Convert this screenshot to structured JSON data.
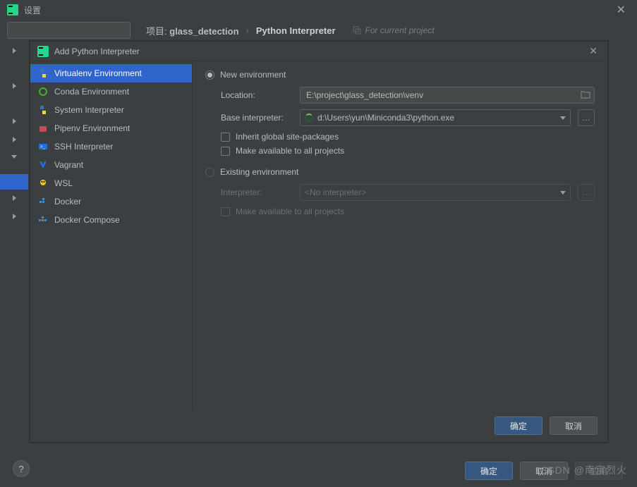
{
  "settings": {
    "title": "设置",
    "search_placeholder": " ",
    "breadcrumb": {
      "project_label": "项目:",
      "project_name": "glass_detection",
      "page": "Python Interpreter"
    },
    "for_current_project": "For current project",
    "footer": {
      "ok": "确定",
      "cancel": "取消",
      "apply": "应用"
    }
  },
  "dialog": {
    "title": "Add Python Interpreter",
    "envs": [
      {
        "label": "Virtualenv Environment",
        "icon": "python-icon",
        "selected": true
      },
      {
        "label": "Conda Environment",
        "icon": "conda-icon"
      },
      {
        "label": "System Interpreter",
        "icon": "python-icon"
      },
      {
        "label": "Pipenv Environment",
        "icon": "pipenv-icon"
      },
      {
        "label": "SSH Interpreter",
        "icon": "ssh-icon"
      },
      {
        "label": "Vagrant",
        "icon": "vagrant-icon"
      },
      {
        "label": "WSL",
        "icon": "linux-icon"
      },
      {
        "label": "Docker",
        "icon": "docker-icon"
      },
      {
        "label": "Docker Compose",
        "icon": "docker-compose-icon"
      }
    ],
    "form": {
      "new_env_label": "New environment",
      "location_label": "Location:",
      "location_value": "E:\\project\\glass_detection\\venv",
      "base_interpreter_label": "Base interpreter:",
      "base_interpreter_value": "d:\\Users\\yun\\Miniconda3\\python.exe",
      "inherit_label": "Inherit global site-packages",
      "make_available_label": "Make available to all projects",
      "existing_env_label": "Existing environment",
      "interpreter_label": "Interpreter:",
      "interpreter_value": "<No interpreter>",
      "make_available_label2": "Make available to all projects"
    },
    "footer": {
      "ok": "确定",
      "cancel": "取消"
    }
  },
  "watermark": "CSDN @南宫烈火"
}
